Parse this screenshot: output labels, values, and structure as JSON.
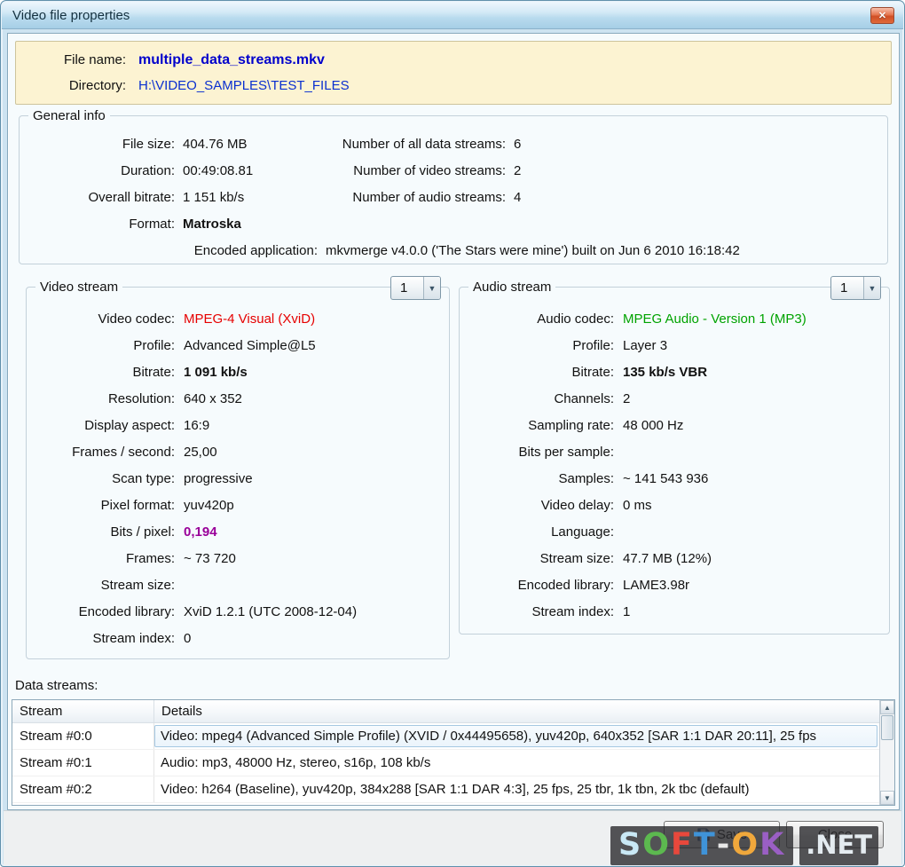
{
  "window": {
    "title": "Video file properties"
  },
  "icons": {
    "close": "✕",
    "dropdown_arrow": "▼",
    "scroll_up": "▲",
    "scroll_down": "▼"
  },
  "file_info": {
    "name_label": "File name:",
    "name_value": "multiple_data_streams.mkv",
    "directory_label": "Directory:",
    "directory_value": "H:\\VIDEO_SAMPLES\\TEST_FILES"
  },
  "general_info": {
    "title": "General info",
    "rows": [
      {
        "l1": "File size:",
        "v1": "404.76 MB",
        "l2": "Number of all data streams:",
        "v2": "6"
      },
      {
        "l1": "Duration:",
        "v1": "00:49:08.81",
        "l2": "Number of video streams:",
        "v2": "2"
      },
      {
        "l1": "Overall bitrate:",
        "v1": "1 151 kb/s",
        "l2": "Number of audio streams:",
        "v2": "4"
      },
      {
        "l1": "Format:",
        "v1": "Matroska",
        "l2": "",
        "v2": ""
      }
    ],
    "encoded_label": "Encoded application:",
    "encoded_value": "mkvmerge v4.0.0 ('The Stars were mine') built on Jun  6 2010 16:18:42"
  },
  "video_stream": {
    "title": "Video stream",
    "selector_value": "1",
    "rows": [
      {
        "label": "Video codec:",
        "value": "MPEG-4 Visual (XviD)"
      },
      {
        "label": "Profile:",
        "value": "Advanced Simple@L5"
      },
      {
        "label": "Bitrate:",
        "value": "1 091 kb/s"
      },
      {
        "label": "Resolution:",
        "value": "640 x 352"
      },
      {
        "label": "Display aspect:",
        "value": "16:9"
      },
      {
        "label": "Frames / second:",
        "value": "25,00"
      },
      {
        "label": "Scan type:",
        "value": "progressive"
      },
      {
        "label": "Pixel format:",
        "value": "yuv420p"
      },
      {
        "label": "Bits / pixel:",
        "value": "0,194"
      },
      {
        "label": "Frames:",
        "value": "~ 73 720"
      },
      {
        "label": "Stream size:",
        "value": ""
      },
      {
        "label": "Encoded library:",
        "value": "XviD 1.2.1 (UTC 2008-12-04)"
      },
      {
        "label": "Stream index:",
        "value": "0"
      }
    ]
  },
  "audio_stream": {
    "title": "Audio stream",
    "selector_value": "1",
    "rows": [
      {
        "label": "Audio codec:",
        "value": "MPEG Audio - Version 1 (MP3)"
      },
      {
        "label": "Profile:",
        "value": "Layer 3"
      },
      {
        "label": "Bitrate:",
        "value": "135 kb/s  VBR"
      },
      {
        "label": "Channels:",
        "value": "2"
      },
      {
        "label": "Sampling rate:",
        "value": "48 000 Hz"
      },
      {
        "label": "Bits per sample:",
        "value": ""
      },
      {
        "label": "Samples:",
        "value": "~ 141 543 936"
      },
      {
        "label": "Video delay:",
        "value": "0 ms"
      },
      {
        "label": "Language:",
        "value": ""
      },
      {
        "label": "Stream size:",
        "value": "47.7 MB (12%)"
      },
      {
        "label": "Encoded library:",
        "value": "LAME3.98r"
      },
      {
        "label": "Stream index:",
        "value": "1"
      }
    ]
  },
  "data_streams": {
    "label": "Data streams:",
    "columns": [
      "Stream",
      "Details"
    ],
    "rows": [
      {
        "stream": "Stream #0:0",
        "details": "Video: mpeg4 (Advanced Simple Profile) (XVID / 0x44495658), yuv420p, 640x352 [SAR 1:1 DAR 20:11], 25 fps"
      },
      {
        "stream": "Stream #0:1",
        "details": "Audio: mp3, 48000 Hz, stereo, s16p, 108 kb/s"
      },
      {
        "stream": "Stream #0:2",
        "details": "Video: h264 (Baseline), yuv420p, 384x288 [SAR 1:1 DAR 4:3], 25 fps, 25 tbr, 1k tbn, 2k tbc (default)"
      }
    ]
  },
  "buttons": {
    "save": "Save",
    "close": "Close"
  },
  "watermark": {
    "letters": [
      {
        "ch": "S",
        "color": "#c9e8f5"
      },
      {
        "ch": "O",
        "color": "#5cb94f"
      },
      {
        "ch": "F",
        "color": "#e8483c"
      },
      {
        "ch": "T",
        "color": "#3f93d8"
      },
      {
        "ch": "-",
        "color": "#e8e8e8"
      },
      {
        "ch": "O",
        "color": "#f0a83c"
      },
      {
        "ch": "K",
        "color": "#9a5fc4"
      }
    ],
    "suffix": ".NET"
  },
  "colors": {
    "video_codec_value": "#e60000",
    "audio_codec_value": "#00a300",
    "bits_per_pixel_value": "#990099",
    "file_name_link": "#0000cc"
  }
}
